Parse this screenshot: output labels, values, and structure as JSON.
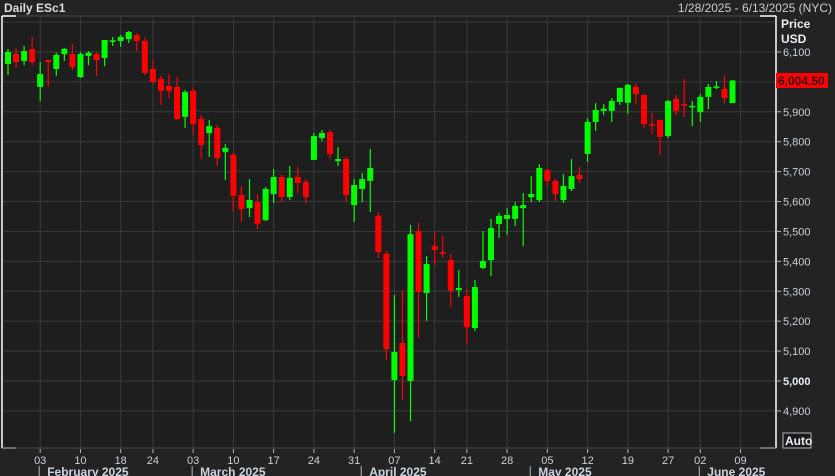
{
  "header": {
    "title": "Daily ESc1",
    "date_range": "1/28/2025 - 6/13/2025 (NYC)"
  },
  "axis": {
    "price_label": "Price",
    "currency_label": "USD",
    "auto_button": "Auto",
    "last_price_label": "6,004.50"
  },
  "colors": {
    "up": "#00ff00",
    "down": "#ff0000",
    "last_price_bg": "#ff0000"
  },
  "chart_data": {
    "type": "candlestick",
    "title": "Daily ESc1",
    "ylabel": "Price USD",
    "ylim": [
      4820,
      6230
    ],
    "yticks": [
      4900,
      5000,
      5100,
      5200,
      5300,
      5400,
      5500,
      5600,
      5700,
      5800,
      5900,
      6000,
      6100
    ],
    "ytick_labels": [
      "4,900",
      "5,000",
      "5,100",
      "5,200",
      "5,300",
      "5,400",
      "5,500",
      "5,600",
      "5,700",
      "5,800",
      "5,900",
      "",
      "6,100"
    ],
    "last_price": 6004.5,
    "xticks": [
      {
        "index": 4,
        "label": "03"
      },
      {
        "index": 9,
        "label": "10"
      },
      {
        "index": 14,
        "label": "18"
      },
      {
        "index": 18,
        "label": "24"
      },
      {
        "index": 23,
        "label": "03"
      },
      {
        "index": 28,
        "label": "10"
      },
      {
        "index": 33,
        "label": "17"
      },
      {
        "index": 38,
        "label": "24"
      },
      {
        "index": 43,
        "label": "31"
      },
      {
        "index": 48,
        "label": "07"
      },
      {
        "index": 53,
        "label": "14"
      },
      {
        "index": 57,
        "label": "21"
      },
      {
        "index": 62,
        "label": "28"
      },
      {
        "index": 67,
        "label": "05"
      },
      {
        "index": 72,
        "label": "12"
      },
      {
        "index": 77,
        "label": "19"
      },
      {
        "index": 82,
        "label": "27"
      },
      {
        "index": 86,
        "label": "02"
      },
      {
        "index": 91,
        "label": "09"
      }
    ],
    "months": [
      {
        "index": 4,
        "label": "February 2025"
      },
      {
        "index": 23,
        "label": "March 2025"
      },
      {
        "index": 44,
        "label": "April 2025"
      },
      {
        "index": 65,
        "label": "May 2025"
      },
      {
        "index": 86,
        "label": "June 2025"
      }
    ],
    "candles": [
      [
        "2025-01-28",
        6060,
        6110,
        6023,
        6100
      ],
      [
        "2025-01-29",
        6093,
        6113,
        6046,
        6066
      ],
      [
        "2025-01-30",
        6070,
        6120,
        6056,
        6103
      ],
      [
        "2025-01-31",
        6110,
        6150,
        6056,
        6066
      ],
      [
        "2025-02-03",
        5983,
        6066,
        5936,
        6026
      ],
      [
        "2025-02-04",
        6073,
        6073,
        5986,
        6066
      ],
      [
        "2025-02-05",
        6043,
        6097,
        6020,
        6090
      ],
      [
        "2025-02-06",
        6093,
        6113,
        6070,
        6110
      ],
      [
        "2025-02-07",
        6093,
        6127,
        6040,
        6050
      ],
      [
        "2025-02-10",
        6016,
        6100,
        6013,
        6093
      ],
      [
        "2025-02-11",
        6087,
        6103,
        6056,
        6097
      ],
      [
        "2025-02-12",
        6093,
        6100,
        6020,
        6073
      ],
      [
        "2025-02-13",
        6080,
        6140,
        6053,
        6140
      ],
      [
        "2025-02-14",
        6137,
        6150,
        6120,
        6139
      ],
      [
        "2025-02-18",
        6137,
        6157,
        6117,
        6150
      ],
      [
        "2025-02-19",
        6143,
        6170,
        6130,
        6167
      ],
      [
        "2025-02-20",
        6157,
        6163,
        6103,
        6137
      ],
      [
        "2025-02-21",
        6137,
        6147,
        6023,
        6030
      ],
      [
        "2025-02-24",
        6043,
        6070,
        5993,
        6000
      ],
      [
        "2025-02-25",
        6010,
        6020,
        5923,
        5970
      ],
      [
        "2025-02-26",
        5986,
        6026,
        5946,
        5970
      ],
      [
        "2025-02-27",
        5983,
        6016,
        5873,
        5876
      ],
      [
        "2025-02-28",
        5883,
        5973,
        5846,
        5966
      ],
      [
        "2025-03-03",
        5970,
        5980,
        5822,
        5859
      ],
      [
        "2025-03-04",
        5876,
        5889,
        5742,
        5789
      ],
      [
        "2025-03-05",
        5829,
        5873,
        5749,
        5852
      ],
      [
        "2025-03-06",
        5846,
        5856,
        5719,
        5745
      ],
      [
        "2025-03-07",
        5766,
        5792,
        5672,
        5779
      ],
      [
        "2025-03-10",
        5756,
        5762,
        5568,
        5619
      ],
      [
        "2025-03-11",
        5622,
        5652,
        5532,
        5575
      ],
      [
        "2025-03-12",
        5578,
        5675,
        5548,
        5605
      ],
      [
        "2025-03-13",
        5598,
        5625,
        5508,
        5525
      ],
      [
        "2025-03-14",
        5538,
        5649,
        5535,
        5642
      ],
      [
        "2025-03-17",
        5625,
        5709,
        5595,
        5682
      ],
      [
        "2025-03-18",
        5682,
        5689,
        5598,
        5615
      ],
      [
        "2025-03-19",
        5615,
        5719,
        5605,
        5679
      ],
      [
        "2025-03-20",
        5682,
        5715,
        5628,
        5662
      ],
      [
        "2025-03-21",
        5665,
        5675,
        5595,
        5615
      ],
      [
        "2025-03-24",
        5739,
        5829,
        5739,
        5819
      ],
      [
        "2025-03-25",
        5812,
        5839,
        5802,
        5829
      ],
      [
        "2025-03-26",
        5832,
        5839,
        5742,
        5759
      ],
      [
        "2025-03-27",
        5735,
        5782,
        5719,
        5742
      ],
      [
        "2025-03-28",
        5742,
        5749,
        5598,
        5622
      ],
      [
        "2025-03-31",
        5588,
        5675,
        5532,
        5655
      ],
      [
        "2025-04-01",
        5642,
        5695,
        5598,
        5675
      ],
      [
        "2025-04-02",
        5669,
        5776,
        5565,
        5712
      ],
      [
        "2025-04-03",
        5552,
        5565,
        5411,
        5431
      ],
      [
        "2025-04-04",
        5425,
        5435,
        5070,
        5107
      ],
      [
        "2025-04-07",
        5003,
        5287,
        4826,
        5097
      ],
      [
        "2025-04-08",
        5127,
        5304,
        4936,
        5017
      ],
      [
        "2025-04-09",
        5000,
        5522,
        4866,
        5491
      ],
      [
        "2025-04-10",
        5501,
        5528,
        5144,
        5298
      ],
      [
        "2025-04-11",
        5294,
        5418,
        5201,
        5391
      ],
      [
        "2025-04-14",
        5451,
        5498,
        5388,
        5438
      ],
      [
        "2025-04-15",
        5431,
        5485,
        5411,
        5425
      ],
      [
        "2025-04-16",
        5404,
        5425,
        5247,
        5301
      ],
      [
        "2025-04-17",
        5304,
        5371,
        5281,
        5311
      ],
      [
        "2025-04-21",
        5284,
        5307,
        5124,
        5180
      ],
      [
        "2025-04-22",
        5177,
        5338,
        5167,
        5314
      ],
      [
        "2025-04-23",
        5378,
        5501,
        5374,
        5401
      ],
      [
        "2025-04-24",
        5404,
        5542,
        5351,
        5511
      ],
      [
        "2025-04-25",
        5525,
        5562,
        5478,
        5552
      ],
      [
        "2025-04-28",
        5542,
        5578,
        5488,
        5555
      ],
      [
        "2025-04-29",
        5542,
        5598,
        5518,
        5585
      ],
      [
        "2025-04-30",
        5578,
        5628,
        5451,
        5588
      ],
      [
        "2025-05-01",
        5615,
        5685,
        5598,
        5625
      ],
      [
        "2025-05-02",
        5605,
        5725,
        5598,
        5712
      ],
      [
        "2025-05-05",
        5705,
        5709,
        5652,
        5669
      ],
      [
        "2025-05-06",
        5669,
        5675,
        5602,
        5625
      ],
      [
        "2025-05-07",
        5605,
        5692,
        5595,
        5652
      ],
      [
        "2025-05-08",
        5642,
        5742,
        5635,
        5685
      ],
      [
        "2025-05-09",
        5689,
        5715,
        5662,
        5675
      ],
      [
        "2025-05-12",
        5759,
        5879,
        5732,
        5866
      ],
      [
        "2025-05-13",
        5866,
        5929,
        5836,
        5906
      ],
      [
        "2025-05-14",
        5903,
        5926,
        5889,
        5910
      ],
      [
        "2025-05-15",
        5903,
        5946,
        5866,
        5936
      ],
      [
        "2025-05-16",
        5933,
        5980,
        5923,
        5980
      ],
      [
        "2025-05-19",
        5930,
        5993,
        5893,
        5990
      ],
      [
        "2025-05-20",
        5983,
        5996,
        5926,
        5959
      ],
      [
        "2025-05-21",
        5956,
        5959,
        5846,
        5859
      ],
      [
        "2025-05-22",
        5859,
        5896,
        5826,
        5856
      ],
      [
        "2025-05-23",
        5873,
        5873,
        5756,
        5816
      ],
      [
        "2025-05-27",
        5819,
        5940,
        5812,
        5936
      ],
      [
        "2025-05-28",
        5943,
        5956,
        5889,
        5903
      ],
      [
        "2025-05-29",
        5926,
        6010,
        5883,
        5923
      ],
      [
        "2025-05-30",
        5915,
        5936,
        5852,
        5920
      ],
      [
        "2025-06-02",
        5899,
        5959,
        5866,
        5950
      ],
      [
        "2025-06-03",
        5950,
        5993,
        5909,
        5983
      ],
      [
        "2025-06-04",
        5980,
        6003,
        5976,
        5985
      ],
      [
        "2025-06-05",
        5976,
        6020,
        5929,
        5946
      ],
      [
        "2025-06-06",
        5929,
        6006,
        5929,
        6004.5
      ]
    ]
  }
}
